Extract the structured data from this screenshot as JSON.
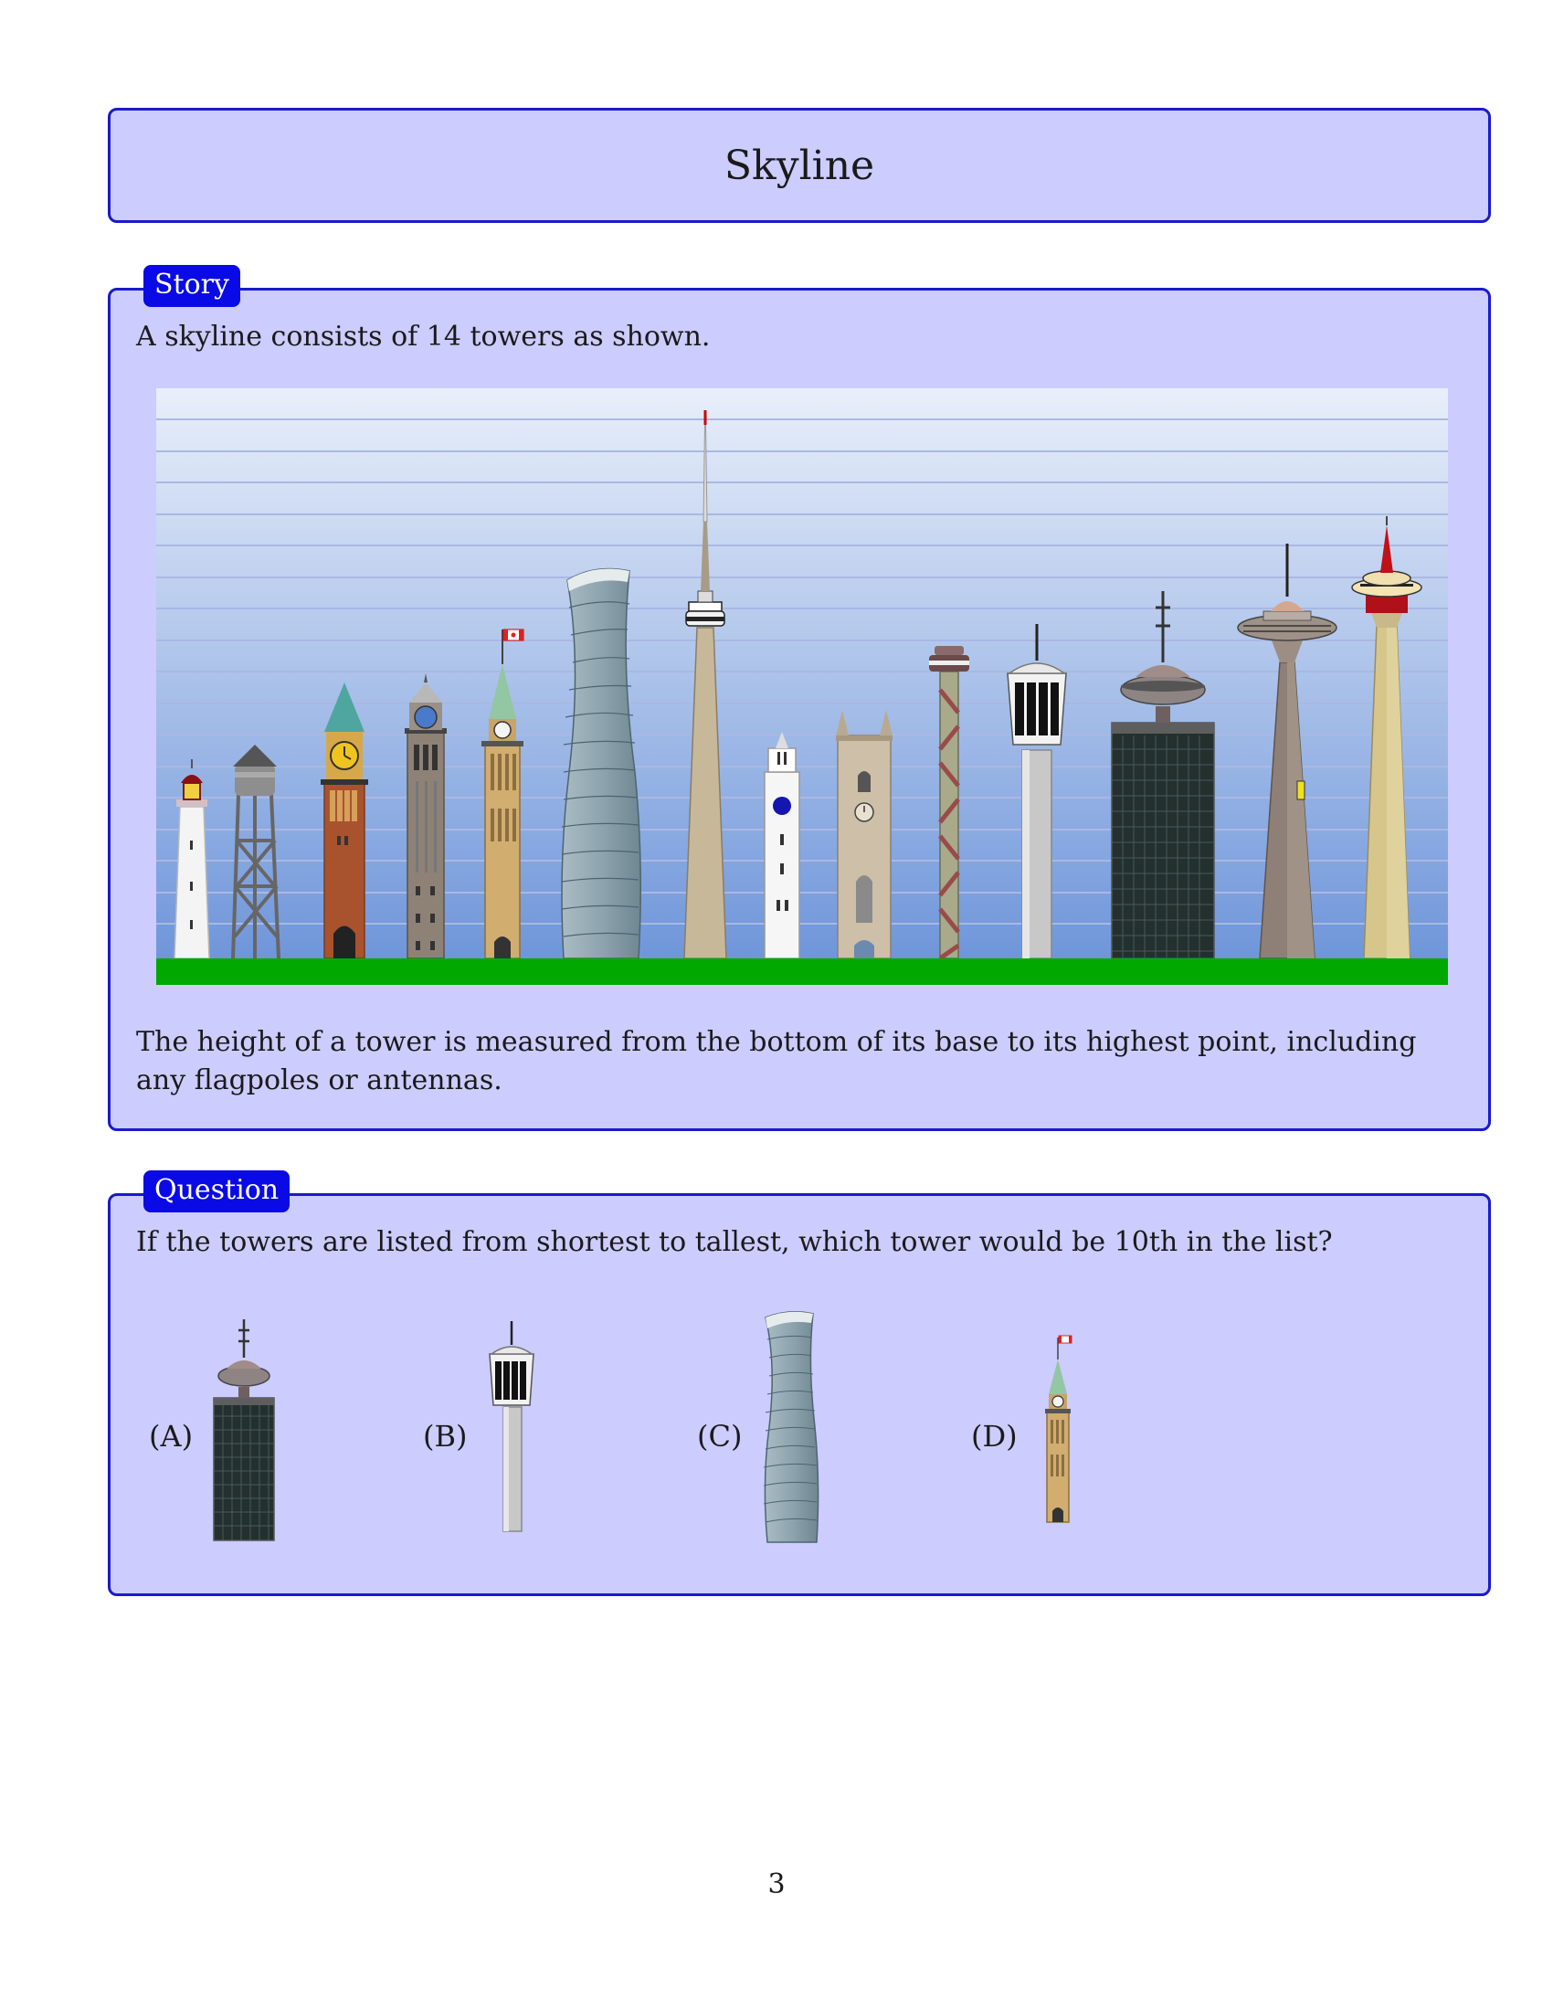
{
  "header": {
    "title": "Skyline"
  },
  "story": {
    "tag": "Story",
    "intro": "A skyline consists of 14 towers as shown.",
    "note": "The height of a tower is measured from the bottom of its base to its highest point, including any flagpoles or antennas."
  },
  "question": {
    "tag": "Question",
    "text": "If the towers are listed from shortest to tallest, which tower would be 10th in the list?",
    "options": [
      {
        "label": "(A)",
        "icon": "dark-office-tower-with-saucer-icon"
      },
      {
        "label": "(B)",
        "icon": "white-observation-tower-icon"
      },
      {
        "label": "(C)",
        "icon": "twisted-glass-tower-icon"
      },
      {
        "label": "(D)",
        "icon": "parliament-clock-tower-icon"
      }
    ]
  },
  "skyline": {
    "tower_count": 14,
    "colors": {
      "sky_top": "#e9effa",
      "sky_bottom": "#6f96da",
      "ground": "#00a800",
      "gridline": "#aab8e2"
    }
  },
  "footer": {
    "page_number": "3"
  }
}
